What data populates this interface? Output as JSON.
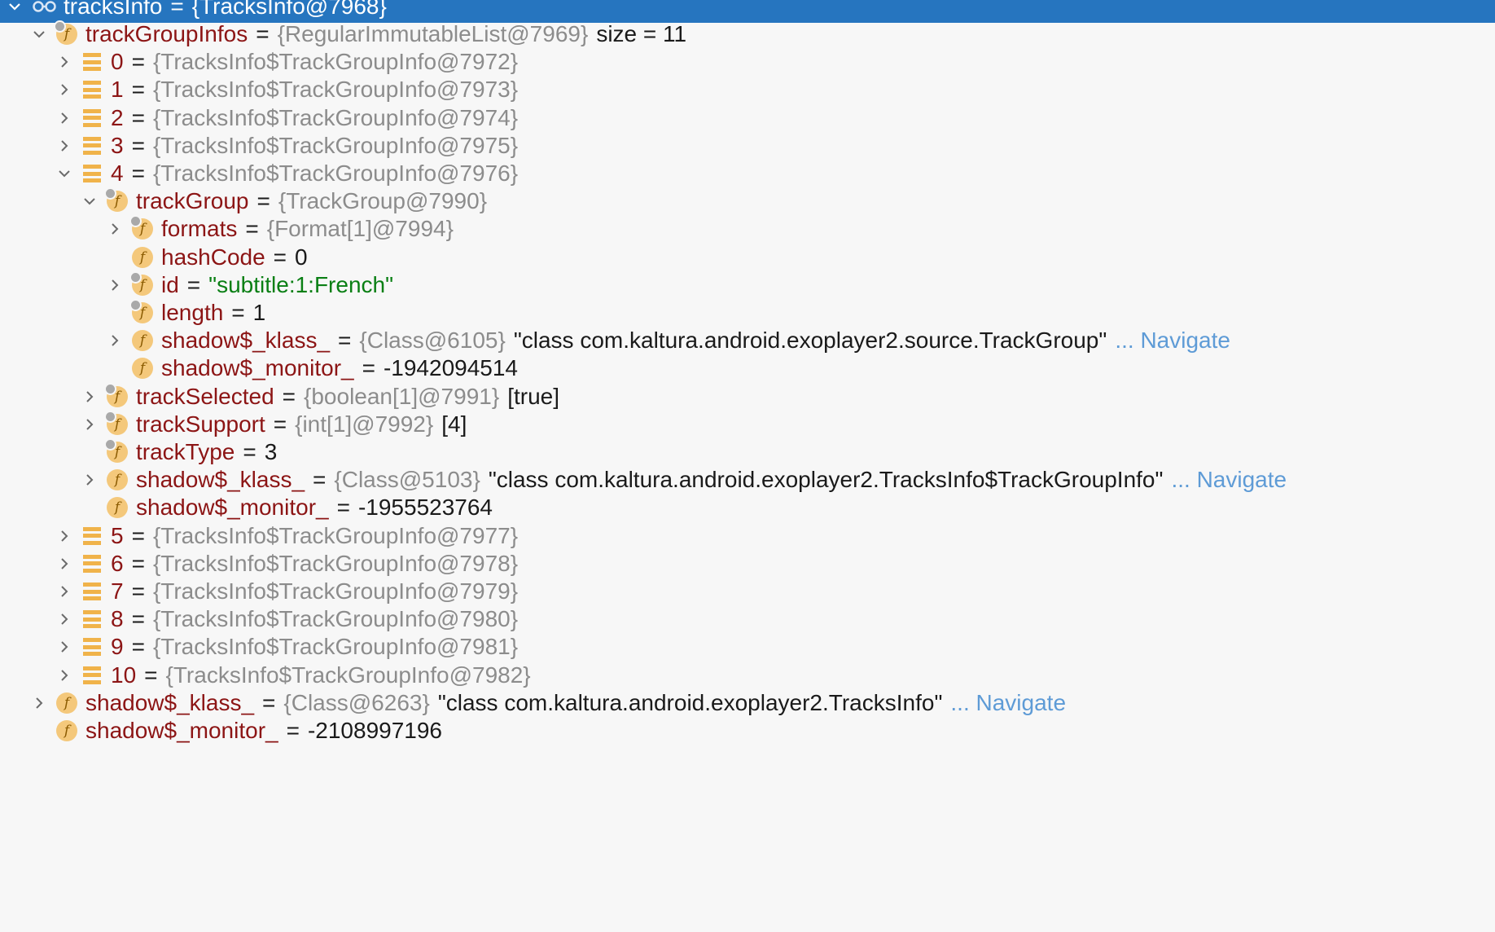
{
  "tree": {
    "root": {
      "name": "tracksInfo",
      "value": "{TracksInfo@7968}"
    },
    "rows": [
      {
        "level": 1,
        "expander": "expanded",
        "icon": "field-marked",
        "name": "trackGroupInfos",
        "type": "{RegularImmutableList@7969}",
        "extra": "size = 11"
      },
      {
        "level": 2,
        "expander": "collapsed",
        "icon": "array",
        "name": "0",
        "type": "{TracksInfo$TrackGroupInfo@7972}"
      },
      {
        "level": 2,
        "expander": "collapsed",
        "icon": "array",
        "name": "1",
        "type": "{TracksInfo$TrackGroupInfo@7973}"
      },
      {
        "level": 2,
        "expander": "collapsed",
        "icon": "array",
        "name": "2",
        "type": "{TracksInfo$TrackGroupInfo@7974}"
      },
      {
        "level": 2,
        "expander": "collapsed",
        "icon": "array",
        "name": "3",
        "type": "{TracksInfo$TrackGroupInfo@7975}"
      },
      {
        "level": 2,
        "expander": "expanded",
        "icon": "array",
        "name": "4",
        "type": "{TracksInfo$TrackGroupInfo@7976}"
      },
      {
        "level": 3,
        "expander": "expanded",
        "icon": "field-marked",
        "name": "trackGroup",
        "type": "{TrackGroup@7990}"
      },
      {
        "level": 4,
        "expander": "collapsed",
        "icon": "field-marked",
        "name": "formats",
        "type": "{Format[1]@7994}"
      },
      {
        "level": 4,
        "expander": "none",
        "icon": "field",
        "name": "hashCode",
        "value": "0"
      },
      {
        "level": 4,
        "expander": "collapsed",
        "icon": "field-marked",
        "name": "id",
        "string": "\"subtitle:1:French\""
      },
      {
        "level": 4,
        "expander": "none",
        "icon": "field-marked",
        "name": "length",
        "value": "1"
      },
      {
        "level": 4,
        "expander": "collapsed",
        "icon": "field",
        "name": "shadow$_klass_",
        "type": "{Class@6105}",
        "quoted": "\"class com.kaltura.android.exoplayer2.source.TrackGroup\"",
        "nav": "... Navigate"
      },
      {
        "level": 4,
        "expander": "none",
        "icon": "field",
        "name": "shadow$_monitor_",
        "value": "-1942094514"
      },
      {
        "level": 3,
        "expander": "collapsed",
        "icon": "field-marked",
        "name": "trackSelected",
        "type": "{boolean[1]@7991}",
        "extra": "[true]"
      },
      {
        "level": 3,
        "expander": "collapsed",
        "icon": "field-marked",
        "name": "trackSupport",
        "type": "{int[1]@7992}",
        "extra": "[4]"
      },
      {
        "level": 3,
        "expander": "none",
        "icon": "field-marked",
        "name": "trackType",
        "value": "3"
      },
      {
        "level": 3,
        "expander": "collapsed",
        "icon": "field",
        "name": "shadow$_klass_",
        "type": "{Class@5103}",
        "quoted": "\"class com.kaltura.android.exoplayer2.TracksInfo$TrackGroupInfo\"",
        "nav": "... Navigate"
      },
      {
        "level": 3,
        "expander": "none",
        "icon": "field",
        "name": "shadow$_monitor_",
        "value": "-1955523764"
      },
      {
        "level": 2,
        "expander": "collapsed",
        "icon": "array",
        "name": "5",
        "type": "{TracksInfo$TrackGroupInfo@7977}"
      },
      {
        "level": 2,
        "expander": "collapsed",
        "icon": "array",
        "name": "6",
        "type": "{TracksInfo$TrackGroupInfo@7978}"
      },
      {
        "level": 2,
        "expander": "collapsed",
        "icon": "array",
        "name": "7",
        "type": "{TracksInfo$TrackGroupInfo@7979}"
      },
      {
        "level": 2,
        "expander": "collapsed",
        "icon": "array",
        "name": "8",
        "type": "{TracksInfo$TrackGroupInfo@7980}"
      },
      {
        "level": 2,
        "expander": "collapsed",
        "icon": "array",
        "name": "9",
        "type": "{TracksInfo$TrackGroupInfo@7981}"
      },
      {
        "level": 2,
        "expander": "collapsed",
        "icon": "array",
        "name": "10",
        "type": "{TracksInfo$TrackGroupInfo@7982}"
      },
      {
        "level": 1,
        "expander": "collapsed",
        "icon": "field",
        "name": "shadow$_klass_",
        "type": "{Class@6263}",
        "quoted": "\"class com.kaltura.android.exoplayer2.TracksInfo\"",
        "nav": "... Navigate"
      },
      {
        "level": 1,
        "expander": "none",
        "icon": "field",
        "name": "shadow$_monitor_",
        "value": "-2108997196"
      }
    ]
  },
  "colors": {
    "selection": "#2675bf",
    "name": "#8c1515",
    "type": "#8c8c8c",
    "string": "#0a7f14",
    "navigate": "#5e9bd6",
    "field_icon": "#f4c87b",
    "array_icon": "#f0b34a"
  },
  "icons": {
    "expanded": "chevron-down-icon",
    "collapsed": "chevron-right-icon",
    "field": "field-icon",
    "array": "array-item-icon",
    "root": "watch-glasses-icon"
  },
  "equals": "="
}
